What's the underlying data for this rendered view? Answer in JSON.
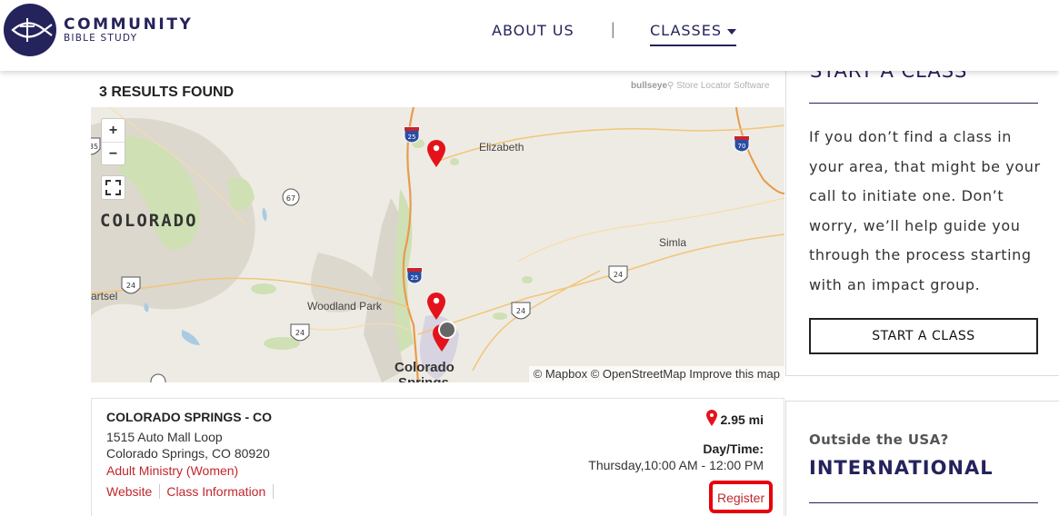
{
  "header": {
    "brand_line1": "COMMUNITY",
    "brand_line2": "BIBLE STUDY",
    "nav": {
      "about": "ABOUT US",
      "separator": "|",
      "classes": "CLASSES"
    },
    "brand_color": "#25235c"
  },
  "results": {
    "count_text": "3 RESULTS FOUND",
    "powered_by": "bullseye",
    "powered_by_suffix": "Store Locator Software"
  },
  "map": {
    "zoom_in": "+",
    "zoom_out": "−",
    "state_label": "COLORADO",
    "places": {
      "elizabeth": "Elizabeth",
      "simla": "Simla",
      "woodland_park": "Woodland Park",
      "colorado_springs_1": "Colorado",
      "colorado_springs_2": "Springs",
      "hartsel": "artsel"
    },
    "shields": [
      "25",
      "70",
      "67",
      "25",
      "24",
      "24",
      "24",
      "24",
      "24"
    ],
    "partial_shield": "35",
    "attribution": "© Mapbox © OpenStreetMap Improve this map",
    "marker_color": "#e4131b"
  },
  "result_card": {
    "title": "COLORADO SPRINGS - CO",
    "address_line1": "1515 Auto Mall Loop",
    "address_line2": "Colorado Springs, CO 80920",
    "ministry": "Adult Ministry (Women)",
    "link_website": "Website",
    "link_class_info": "Class Information",
    "distance": "2.95 mi",
    "day_time_label": "Day/Time:",
    "day_time_value": "Thursday,10:00 AM - 12:00 PM",
    "register": "Register"
  },
  "side_panel": {
    "heading": "START A CLASS",
    "body": "If you don’t find a class in your area, that might be your call to initiate one. Don’t worry, we’ll help guide you through the process starting with an impact group.",
    "button": "START A CLASS",
    "intl_question": "Outside the USA?",
    "intl_heading": "INTERNATIONAL"
  }
}
